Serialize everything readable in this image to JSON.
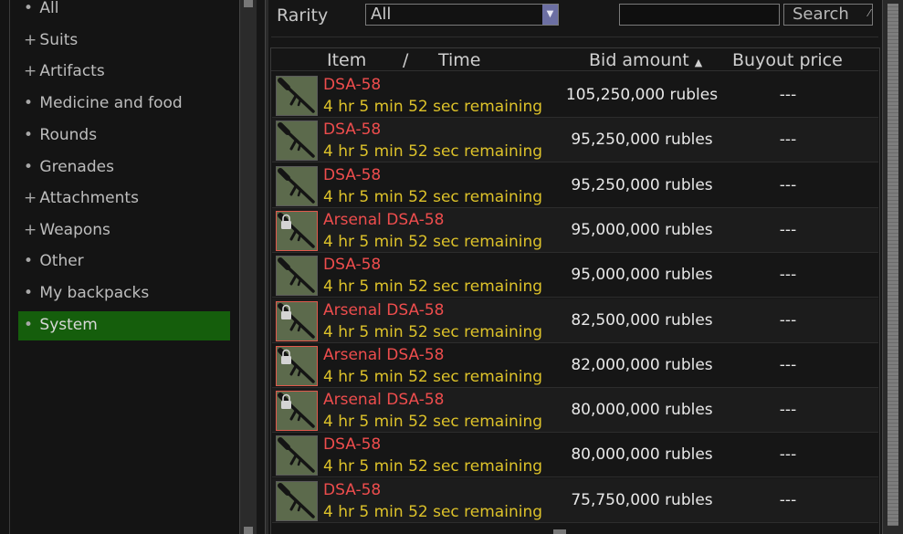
{
  "categories": [
    {
      "mark": "•",
      "label": "All"
    },
    {
      "mark": "+",
      "label": "Suits"
    },
    {
      "mark": "+",
      "label": "Artifacts"
    },
    {
      "mark": "•",
      "label": "Medicine and food"
    },
    {
      "mark": "•",
      "label": "Rounds"
    },
    {
      "mark": "•",
      "label": "Grenades"
    },
    {
      "mark": "+",
      "label": "Attachments"
    },
    {
      "mark": "+",
      "label": "Weapons"
    },
    {
      "mark": "•",
      "label": "Other"
    },
    {
      "mark": "•",
      "label": "My backpacks"
    },
    {
      "mark": "•",
      "label": "System",
      "selected": true
    }
  ],
  "filter": {
    "rarity_label": "Rarity",
    "rarity_value": "All",
    "search_value": "",
    "search_button": "Search"
  },
  "columns": {
    "item": "Item",
    "separator": "/",
    "time": "Time",
    "bid": "Bid amount",
    "bid_sort_icon": "sort-arrow-up-icon",
    "buyout": "Buyout price"
  },
  "listings": [
    {
      "name": "DSA-58",
      "time": "4 hr 5 min 52 sec remaining",
      "bid": "105,250,000 rubles",
      "buyout": "---",
      "locked": false
    },
    {
      "name": "DSA-58",
      "time": "4 hr 5 min 52 sec remaining",
      "bid": "95,250,000 rubles",
      "buyout": "---",
      "locked": false
    },
    {
      "name": "DSA-58",
      "time": "4 hr 5 min 52 sec remaining",
      "bid": "95,250,000 rubles",
      "buyout": "---",
      "locked": false
    },
    {
      "name": "Arsenal DSA-58",
      "time": "4 hr 5 min 52 sec remaining",
      "bid": "95,000,000 rubles",
      "buyout": "---",
      "locked": true
    },
    {
      "name": "DSA-58",
      "time": "4 hr 5 min 52 sec remaining",
      "bid": "95,000,000 rubles",
      "buyout": "---",
      "locked": false
    },
    {
      "name": "Arsenal DSA-58",
      "time": "4 hr 5 min 52 sec remaining",
      "bid": "82,500,000 rubles",
      "buyout": "---",
      "locked": true
    },
    {
      "name": "Arsenal DSA-58",
      "time": "4 hr 5 min 52 sec remaining",
      "bid": "82,000,000 rubles",
      "buyout": "---",
      "locked": true
    },
    {
      "name": "Arsenal DSA-58",
      "time": "4 hr 5 min 52 sec remaining",
      "bid": "80,000,000 rubles",
      "buyout": "---",
      "locked": true
    },
    {
      "name": "DSA-58",
      "time": "4 hr 5 min 52 sec remaining",
      "bid": "80,000,000 rubles",
      "buyout": "---",
      "locked": false
    },
    {
      "name": "DSA-58",
      "time": "4 hr 5 min 52 sec remaining",
      "bid": "75,750,000 rubles",
      "buyout": "---",
      "locked": false
    }
  ],
  "colors": {
    "item_name": "#ee4d4d",
    "time_remaining": "#ddc22a",
    "selected_category": "#155e0c",
    "arsenal_border": "#e0594c"
  }
}
